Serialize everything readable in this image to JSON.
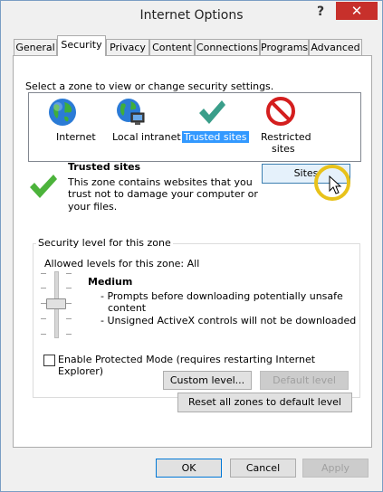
{
  "window": {
    "title": "Internet Options",
    "help_label": "?",
    "close_label": "✕"
  },
  "tabs": [
    "General",
    "Security",
    "Privacy",
    "Content",
    "Connections",
    "Programs",
    "Advanced"
  ],
  "zones": {
    "prompt": "Select a zone to view or change security settings.",
    "items": [
      {
        "label": "Internet",
        "icon": "globe-icon",
        "selected": false
      },
      {
        "label": "Local intranet",
        "icon": "intranet-globe-icon",
        "selected": false
      },
      {
        "label": "Trusted sites",
        "icon": "checkmark-icon",
        "selected": true
      },
      {
        "label_line1": "Restricted",
        "label_line2": "sites",
        "icon": "restricted-icon",
        "selected": false
      }
    ]
  },
  "detail": {
    "title": "Trusted sites",
    "description": [
      "This zone contains websites that you",
      "trust not to damage your computer or",
      "your files."
    ],
    "sites_button": "Sites"
  },
  "security_level": {
    "group_title": "Security level for this zone",
    "allowed": "Allowed levels for this zone: All",
    "level_name": "Medium",
    "bullets": [
      "- Prompts before downloading potentially unsafe",
      "content",
      "- Unsigned ActiveX controls will not be downloaded"
    ],
    "slider_level_index": 2,
    "slider_levels": 5,
    "protected_mode_label": "Enable Protected Mode (requires restarting Internet Explorer)",
    "protected_mode_checked": false,
    "custom_level_button": "Custom level...",
    "default_level_button": "Default level"
  },
  "reset_button": "Reset all zones to default level",
  "footer": {
    "ok": "OK",
    "cancel": "Cancel",
    "apply": "Apply"
  },
  "colors": {
    "selection": "#3399ff",
    "close": "#c7302b",
    "cursor_highlight": "#e8c21a"
  }
}
